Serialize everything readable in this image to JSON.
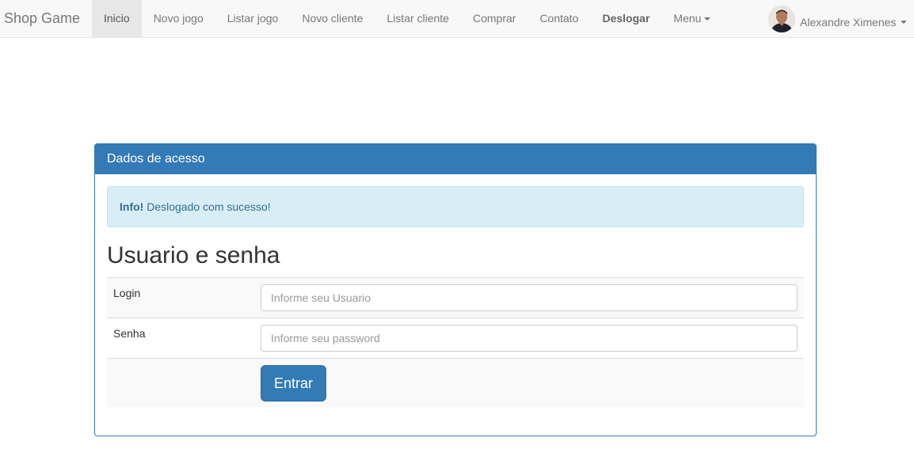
{
  "navbar": {
    "brand": "Shop Game",
    "items": [
      {
        "label": "Inicio",
        "active": true
      },
      {
        "label": "Novo jogo"
      },
      {
        "label": "Listar jogo"
      },
      {
        "label": "Novo cliente"
      },
      {
        "label": "Listar cliente"
      },
      {
        "label": "Comprar"
      },
      {
        "label": "Contato"
      },
      {
        "label": "Deslogar",
        "bold": true
      },
      {
        "label": "Menu",
        "dropdown": true
      }
    ],
    "user": {
      "name": "Alexandre Ximenes",
      "avatar_icon": "user-avatar"
    }
  },
  "panel": {
    "heading": "Dados de acesso",
    "alert": {
      "strong": "Info!",
      "message": "Deslogado com sucesso!"
    },
    "title": "Usuario e senha",
    "login": {
      "label": "Login",
      "placeholder": "Informe seu Usuario",
      "value": ""
    },
    "senha": {
      "label": "Senha",
      "placeholder": "Informe seu password",
      "value": ""
    },
    "submit_label": "Entrar"
  },
  "colors": {
    "primary": "#337ab7",
    "alert_bg": "#d9edf7",
    "alert_text": "#31708f",
    "navbar_bg": "#f8f8f8"
  }
}
